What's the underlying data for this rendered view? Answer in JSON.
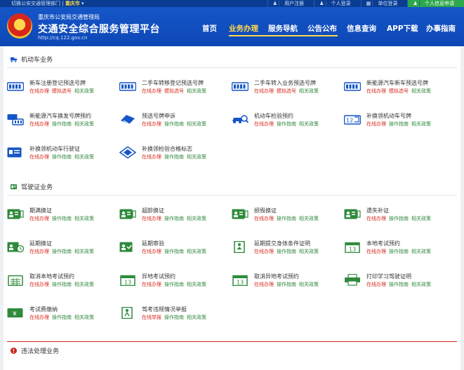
{
  "topbar": {
    "left_text": "切换公安交通管理部门",
    "city": "重庆市",
    "links": [
      "用户注册",
      "个人登录",
      "单位登录",
      "个人信息申请"
    ]
  },
  "header": {
    "org": "重庆市公安局交通管理局",
    "platform": "交通安全综合服务管理平台",
    "url": "http://cq.122.gov.cn",
    "nav": [
      "首页",
      "业务办理",
      "服务导航",
      "公告公布",
      "信息查询",
      "APP下载",
      "办事指南"
    ],
    "active_nav": "业务办理"
  },
  "colors": {
    "brand": "#1556c8",
    "accent": "#ffd84a",
    "red": "#d92b1f",
    "green": "#2f8a3c"
  },
  "vehicle": {
    "title": "机动车业务",
    "items": [
      {
        "title": "新车注册登记预选号牌",
        "l1": "在线办理",
        "l2": "模拟选号",
        "l3": "相关政策",
        "icon": "plate-icon"
      },
      {
        "title": "二手车转移登记预选号牌",
        "l1": "在线办理",
        "l2": "模拟选号",
        "l3": "相关政策",
        "icon": "plate-icon"
      },
      {
        "title": "二手车转入业务预选号牌",
        "l1": "在线办理",
        "l2": "模拟选号",
        "l3": "相关政策",
        "icon": "plate-icon"
      },
      {
        "title": "新能源汽车新车预选号牌",
        "l1": "在线办理",
        "l2": "模拟选号",
        "l3": "相关政策",
        "icon": "plate-icon"
      },
      {
        "title": "新能源汽车换发号牌预约",
        "l1": "在线办理",
        "l2": "操作指南",
        "l3": "相关政策",
        "icon": "plate-swap-icon"
      },
      {
        "title": "预选号牌申诉",
        "l1": "在线办理",
        "l2": "操作指南",
        "l3": "相关政策",
        "icon": "plate-appeal-icon"
      },
      {
        "title": "机动车检验预约",
        "l1": "在线办理",
        "l2": "操作指南",
        "l3": "相关政策",
        "icon": "car-inspect-icon"
      },
      {
        "title": "补换领机动车号牌",
        "l1": "在线办理",
        "l2": "操作指南",
        "l3": "相关政策",
        "icon": "plate-replace-icon"
      },
      {
        "title": "补换领机动车行驶证",
        "l1": "在线办理",
        "l2": "操作指南",
        "l3": "相关政策",
        "icon": "license-card-icon"
      },
      {
        "title": "补换领检验合格标志",
        "l1": "在线办理",
        "l2": "操作指南",
        "l3": "相关政策",
        "icon": "inspection-mark-icon"
      }
    ]
  },
  "driving": {
    "title": "驾驶证业务",
    "items": [
      {
        "title": "期满换证",
        "l1": "在线办理",
        "l2": "操作指南",
        "l3": "相关政策",
        "icon": "id-card-icon"
      },
      {
        "title": "超龄换证",
        "l1": "在线办理",
        "l2": "操作指南",
        "l3": "相关政策",
        "icon": "id-card-icon"
      },
      {
        "title": "损毁换证",
        "l1": "在线办理",
        "l2": "操作指南",
        "l3": "相关政策",
        "icon": "id-card-icon"
      },
      {
        "title": "遗失补证",
        "l1": "在线办理",
        "l2": "操作指南",
        "l3": "相关政策",
        "icon": "id-card-icon"
      },
      {
        "title": "延期换证",
        "l1": "在线办理",
        "l2": "操作指南",
        "l3": "相关政策",
        "icon": "id-card-clock-icon"
      },
      {
        "title": "延期审验",
        "l1": "在线办理",
        "l2": "操作指南",
        "l3": "相关政策",
        "icon": "id-card-check-icon"
      },
      {
        "title": "延期提交身体条件证明",
        "l1": "在线办理",
        "l2": "操作指南",
        "l3": "相关政策",
        "icon": "person-doc-icon"
      },
      {
        "title": "本地考试预约",
        "l1": "在线办理",
        "l2": "操作指南",
        "l3": "相关政策",
        "icon": "calendar-icon"
      },
      {
        "title": "取消本地考试预约",
        "l1": "在线办理",
        "l2": "操作指南",
        "l3": "相关政策",
        "icon": "cancel-calendar-icon"
      },
      {
        "title": "异地考试预约",
        "l1": "在线办理",
        "l2": "操作指南",
        "l3": "相关政策",
        "icon": "calendar-icon"
      },
      {
        "title": "取消异地考试预约",
        "l1": "在线办理",
        "l2": "操作指南",
        "l3": "相关政策",
        "icon": "calendar-icon"
      },
      {
        "title": "打印学习驾驶证明",
        "l1": "在线办理",
        "l2": "操作指南",
        "l3": "相关政策",
        "icon": "printer-icon"
      },
      {
        "title": "考试费缴纳",
        "l1": "在线办理",
        "l2": "操作指南",
        "l3": "相关政策",
        "icon": "payment-icon"
      },
      {
        "title": "驾考违规情况举报",
        "l1": "在线举报",
        "l2": "操作指南",
        "l3": "相关政策",
        "icon": "report-icon"
      }
    ]
  },
  "violation": {
    "title": "违法处理业务"
  }
}
